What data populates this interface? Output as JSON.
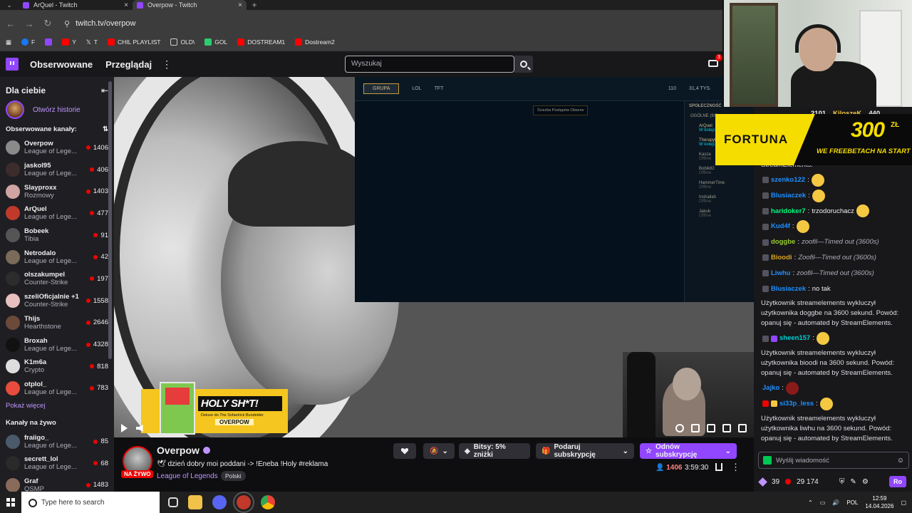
{
  "browser": {
    "tabs": [
      {
        "title": "ArQuel - Twitch",
        "active": false
      },
      {
        "title": "Overpow - Twitch",
        "active": true
      }
    ],
    "url": "twitch.tv/overpow",
    "bookmarks": [
      {
        "label": "F",
        "color": "#1877f2"
      },
      {
        "label": "",
        "color": "#9146ff"
      },
      {
        "label": "Y",
        "color": "#ff0000"
      },
      {
        "label": "T",
        "color": "#ffffff"
      },
      {
        "label": "CHIL PLAYLIST",
        "color": "#ff0000"
      },
      {
        "label": "OLD\\",
        "color": "#cccccc"
      },
      {
        "label": "GOL",
        "color": "#2ecc71"
      },
      {
        "label": "DOSTREAM1",
        "color": "#ff0000"
      },
      {
        "label": "Dostream2",
        "color": "#ff0000"
      }
    ]
  },
  "topnav": {
    "following": "Obserwowane",
    "browse": "Przeglądaj",
    "search_placeholder": "Wyszukaj",
    "notif_count": "3"
  },
  "sidebar": {
    "title": "Dla ciebie",
    "history_link": "Otwórz historie",
    "followed_heading": "Obserwowane kanały:",
    "followed": [
      {
        "name": "Overpow",
        "game": "League of Lege...",
        "viewers": "1406",
        "color": "#8a8a8a"
      },
      {
        "name": "jaskol95",
        "game": "League of Lege...",
        "viewers": "406",
        "color": "#3d2c2c"
      },
      {
        "name": "Slayproxx",
        "game": "Rozmowy",
        "viewers": "1403",
        "color": "#d1a4a4"
      },
      {
        "name": "ArQuel",
        "game": "League of Lege...",
        "viewers": "477",
        "color": "#c0392b"
      },
      {
        "name": "Bobeek",
        "game": "Tibia",
        "viewers": "91",
        "color": "#555555"
      },
      {
        "name": "Netrodalo",
        "game": "League of Lege...",
        "viewers": "42",
        "color": "#7a6a5a"
      },
      {
        "name": "olszakumpel",
        "game": "Counter-Strike",
        "viewers": "197",
        "color": "#2c2c2c"
      },
      {
        "name": "szeliOficjalnie +1",
        "game": "Counter-Strike",
        "viewers": "1558",
        "color": "#e8c0c0"
      },
      {
        "name": "Thijs",
        "game": "Hearthstone",
        "viewers": "2646",
        "color": "#6b4a3a"
      },
      {
        "name": "Broxah",
        "game": "League of Lege...",
        "viewers": "4328",
        "color": "#111111"
      },
      {
        "name": "K1m6a",
        "game": "Crypto",
        "viewers": "818",
        "color": "#dddddd"
      },
      {
        "name": "otplol_",
        "game": "League of Lege...",
        "viewers": "783",
        "color": "#e74c3c"
      }
    ],
    "show_more": "Pokaż więcej",
    "live_heading": "Kanały na żywo",
    "live": [
      {
        "name": "fraiigo_",
        "game": "League of Lege...",
        "viewers": "85",
        "color": "#4a5a6a"
      },
      {
        "name": "secrett_lol",
        "game": "League of Lege...",
        "viewers": "68",
        "color": "#2a2a2a"
      },
      {
        "name": "Graf",
        "game": "QSMP",
        "viewers": "1483",
        "color": "#8a6a5a"
      }
    ]
  },
  "game_client": {
    "party_label": "GRUPA",
    "tab_lol": "LOL",
    "tab_tft": "TFT",
    "tooltip": "Ścieżka Postępów Obserw",
    "currency_1": "110",
    "currency_2": "31,4 TYS.",
    "social_heading": "SPOŁECZNOŚĆ",
    "group_heading": "OGÓLNE (8/9)",
    "friends": [
      {
        "name": "ArQuel",
        "status": "W kolejce",
        "online": true
      },
      {
        "name": "TherapyNasos",
        "status": "W kolejce",
        "online": true
      },
      {
        "name": "Kasza",
        "status": "Offline",
        "online": false
      },
      {
        "name": "Bobik82",
        "status": "Offline",
        "online": false
      },
      {
        "name": "HammerTime",
        "status": "Offline",
        "online": false
      },
      {
        "name": "Inshallah",
        "status": "Offline",
        "online": false
      },
      {
        "name": "Jakub",
        "status": "Offline",
        "online": false
      }
    ]
  },
  "overlay": {
    "holy_title": "HOLY SH*T!",
    "holy_sub": "Deluxe do The Sofaelrick Bundelder",
    "holy_brand": "OVERPOW"
  },
  "stream": {
    "channel": "Overpow",
    "title": "🕊 dzień dobry moi poddani -> !Eneba !Holy #reklama",
    "game": "League of Legends",
    "tag": "Polski",
    "live_label": "NA ŻYWO",
    "bits_label": "Bitsy: 5% zniżki",
    "gift_label": "Podaruj subskrypcję",
    "subscribe_label": "Odnów subskrypcję",
    "viewers": "1406",
    "uptime": "3:59:30"
  },
  "promo": {
    "brand": "FORTUNA",
    "amount": "300",
    "currency": "ZŁ",
    "text": "WE FREEBETACH NA START"
  },
  "chat": {
    "top_stats": {
      "count_1": "2101",
      "user": "KiloszeK",
      "count_2": "440"
    },
    "truncated_line": "StreamElements.",
    "messages": [
      {
        "user": "szenko122",
        "color": "#1e90ff",
        "text": "",
        "timeout": false,
        "emote": true
      },
      {
        "user": "Blusiaczek",
        "color": "#1e90ff",
        "text": "",
        "timeout": false,
        "emote": true
      },
      {
        "user": "haridoker7",
        "color": "#00ff7f",
        "text": "trzodoruchacz",
        "timeout": false,
        "emote": true
      },
      {
        "user": "Kud4f",
        "color": "#1e90ff",
        "text": "",
        "timeout": false,
        "emote": true
      },
      {
        "user": "doggbe",
        "color": "#9acd32",
        "text": "zoofil—Timed out (3600s)",
        "timeout": true,
        "emote": false
      },
      {
        "user": "Bioodi",
        "color": "#daa520",
        "text": "Zoofil—Timed out (3600s)",
        "timeout": true,
        "emote": false
      },
      {
        "user": "Liwhu",
        "color": "#1e90ff",
        "text": "zoofil—Timed out (3600s)",
        "timeout": true,
        "emote": false
      },
      {
        "user": "Blusiaczek",
        "color": "#1e90ff",
        "text": "no tak",
        "timeout": false,
        "emote": false
      }
    ],
    "system_1": "Użytkownik streamelements wykluczył użytkownika doggbe na 3600 sekund. Powód: opanuj się - automated by StreamElements.",
    "msg_sheen": {
      "user": "sheen157",
      "color": "#00ced1"
    },
    "system_2": "Użytkownik streamelements wykluczył użytkownika bioodi na 3600 sekund. Powód: opanuj się - automated by StreamElements.",
    "msg_jajko": {
      "user": "Jajko",
      "color": "#1e90ff"
    },
    "msg_si33p": {
      "user": "si33p_less",
      "color": "#1e90ff"
    },
    "system_3": "Użytkownik streamelements wykluczył użytkownika liwhu na 3600 sekund. Powód: opanuj się - automated by StreamElements.",
    "input_placeholder": "Wyślij wiadomość",
    "points": "39",
    "bits": "29 174",
    "chat_button": "Ro"
  },
  "taskbar": {
    "search_placeholder": "Type here to search",
    "lang": "POL",
    "time": "12:59",
    "date": "14.04.2026"
  }
}
